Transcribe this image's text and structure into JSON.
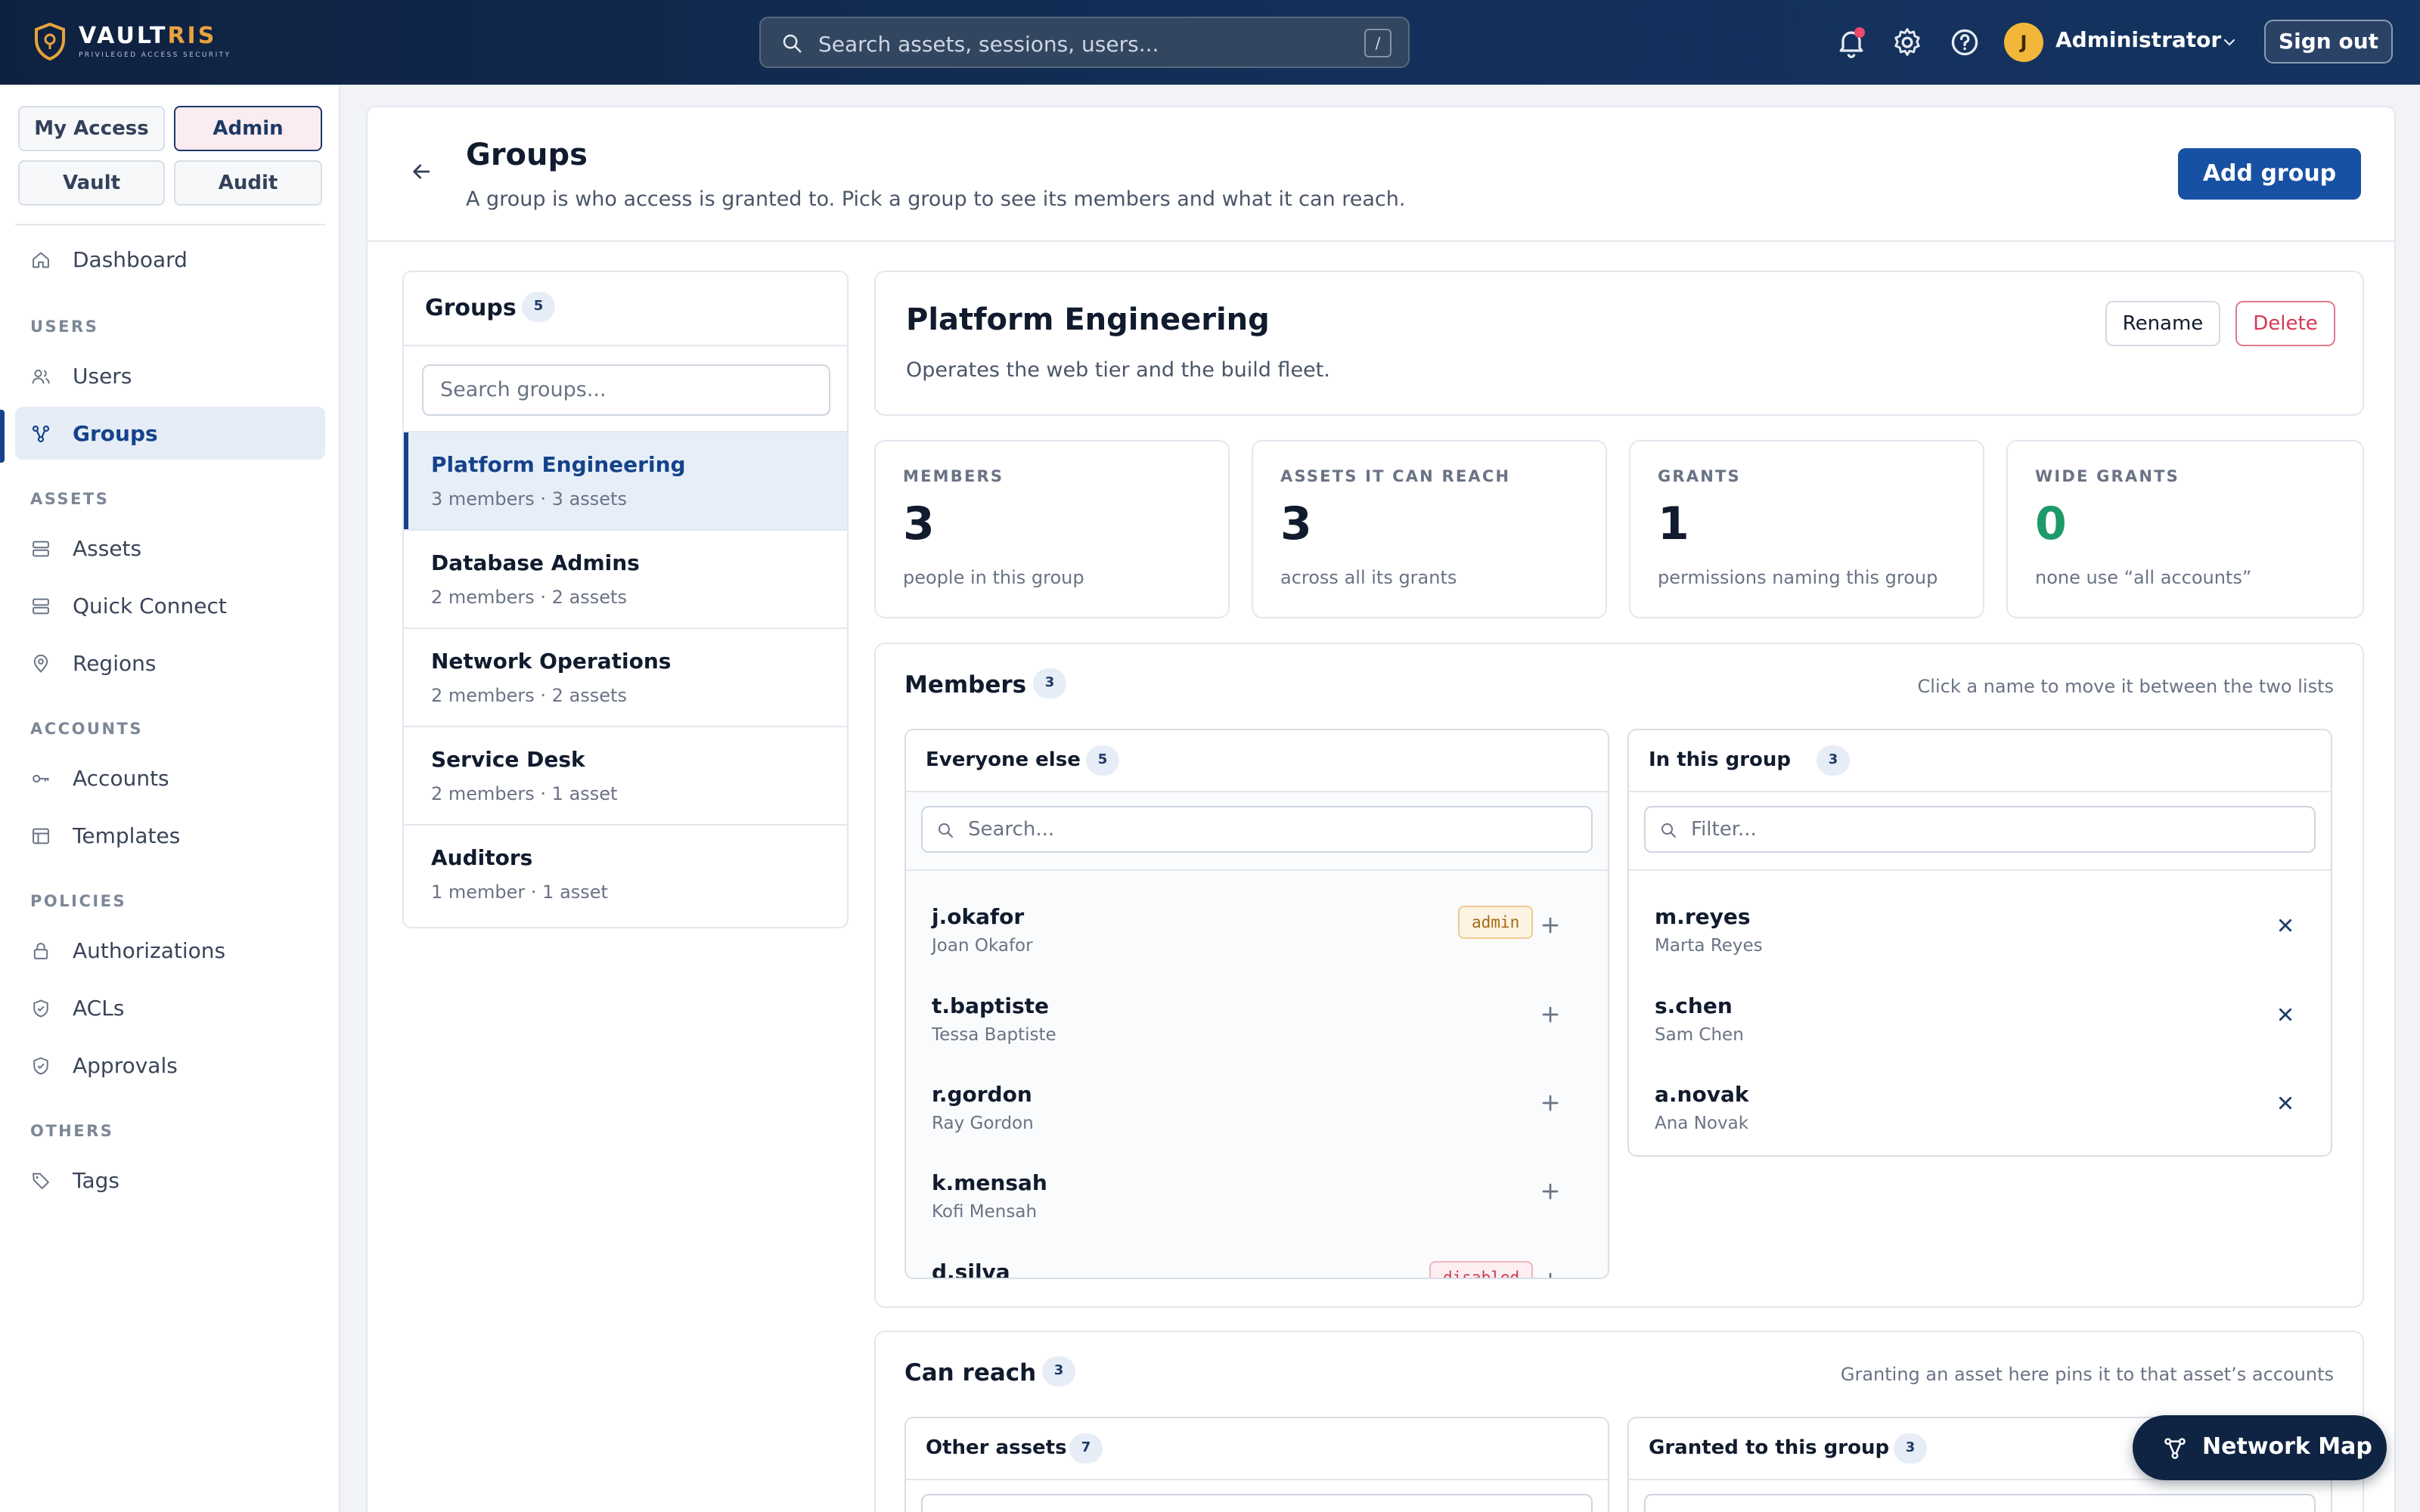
{
  "brand": {
    "name_a": "VAULT",
    "name_b": "RIS",
    "tagline": "PRIVILEGED ACCESS SECURITY"
  },
  "topbar": {
    "search_placeholder": "Search assets, sessions, users...",
    "search_shortcut": "/",
    "user_initial": "J",
    "user_name": "Administrator",
    "signout_label": "Sign out"
  },
  "sidebar": {
    "switcher": [
      "My Access",
      "Admin",
      "Vault",
      "Audit"
    ],
    "active_switch": "Admin",
    "dashboard": "Dashboard",
    "sections": {
      "users": "USERS",
      "assets": "ASSETS",
      "accounts": "ACCOUNTS",
      "policies": "POLICIES",
      "others": "OTHERS"
    },
    "items": {
      "users": "Users",
      "groups": "Groups",
      "assets": "Assets",
      "quick_connect": "Quick Connect",
      "regions": "Regions",
      "accounts": "Accounts",
      "templates": "Templates",
      "authorizations": "Authorizations",
      "acls": "ACLs",
      "approvals": "Approvals",
      "tags": "Tags"
    },
    "active_item": "Groups"
  },
  "page": {
    "title": "Groups",
    "subtitle": "A group is who access is granted to. Pick a group to see its members and what it can reach.",
    "add_button": "Add group"
  },
  "groups_panel": {
    "title": "Groups",
    "count": "5",
    "search_placeholder": "Search groups...",
    "groups": [
      {
        "name": "Platform Engineering",
        "meta": "3 members · 3 assets"
      },
      {
        "name": "Database Admins",
        "meta": "2 members · 2 assets"
      },
      {
        "name": "Network Operations",
        "meta": "2 members · 2 assets"
      },
      {
        "name": "Service Desk",
        "meta": "2 members · 1 asset"
      },
      {
        "name": "Auditors",
        "meta": "1 member · 1 asset"
      }
    ],
    "selected": "Platform Engineering"
  },
  "group": {
    "name": "Platform Engineering",
    "description": "Operates the web tier and the build fleet.",
    "rename_label": "Rename",
    "delete_label": "Delete"
  },
  "stats": [
    {
      "label": "MEMBERS",
      "value": "3",
      "note": "people in this group"
    },
    {
      "label": "ASSETS IT CAN REACH",
      "value": "3",
      "note": "across all its grants"
    },
    {
      "label": "GRANTS",
      "value": "1",
      "note": "permissions naming this group"
    },
    {
      "label": "WIDE GRANTS",
      "value": "0",
      "note": "none use “all accounts”",
      "color": "#1e9a6a"
    }
  ],
  "members": {
    "title": "Members",
    "count": "3",
    "hint": "Click a name to move it between the two lists",
    "everyone_else": {
      "title": "Everyone else",
      "count": "5",
      "placeholder": "Search...",
      "people": [
        {
          "user": "j.okafor",
          "name": "Joan Okafor",
          "tag": "admin"
        },
        {
          "user": "t.baptiste",
          "name": "Tessa Baptiste"
        },
        {
          "user": "r.gordon",
          "name": "Ray Gordon"
        },
        {
          "user": "k.mensah",
          "name": "Kofi Mensah"
        },
        {
          "user": "d.silva",
          "name": "",
          "tag": "disabled"
        }
      ]
    },
    "in_group": {
      "title": "In this group",
      "count": "3",
      "placeholder": "Filter...",
      "people": [
        {
          "user": "m.reyes",
          "name": "Marta Reyes"
        },
        {
          "user": "s.chen",
          "name": "Sam Chen"
        },
        {
          "user": "a.novak",
          "name": "Ana Novak"
        }
      ]
    }
  },
  "can_reach": {
    "title": "Can reach",
    "count": "3",
    "hint": "Granting an asset here pins it to that asset’s accounts",
    "other_assets": {
      "title": "Other assets",
      "count": "7"
    },
    "granted": {
      "title": "Granted to this group",
      "count": "3"
    }
  },
  "fab": {
    "label": "Network Map"
  },
  "colors": {
    "brand_navy": "#0f2140",
    "accent": "#1751a3",
    "gold": "#e8a33d",
    "danger": "#d43754",
    "success": "#1e9a6a"
  }
}
